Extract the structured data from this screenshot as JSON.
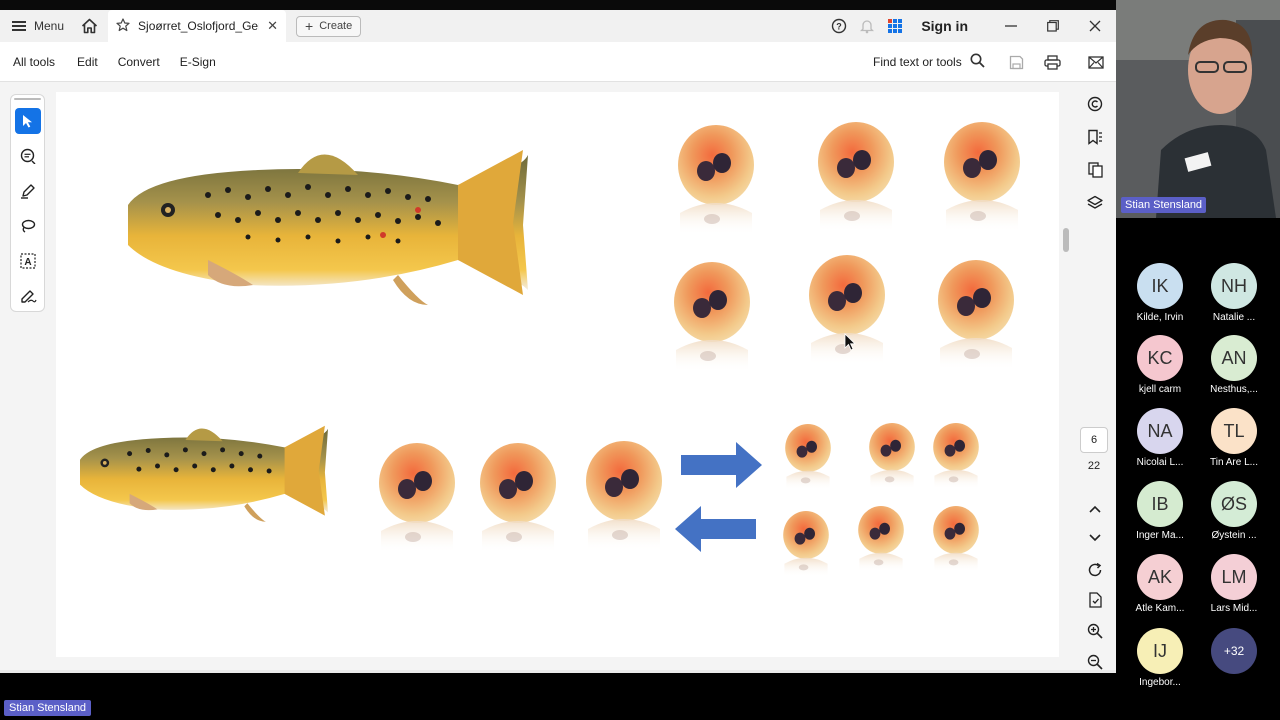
{
  "titlebar": {
    "menu_label": "Menu",
    "tab_title": "Sjoørret_Oslofjord_Gen...",
    "create_label": "Create",
    "sign_in_label": "Sign in"
  },
  "toolbar": {
    "items": [
      "All tools",
      "Edit",
      "Convert",
      "E-Sign"
    ],
    "find_label": "Find text or tools"
  },
  "page_nav": {
    "current_page": "6",
    "total_pages": "22"
  },
  "meeting": {
    "speaker_name": "Stian Stensland",
    "presenter_tag": "Stian Stensland",
    "participants": [
      {
        "initials": "IK",
        "name": "Kilde, Irvin",
        "color": "#c9dff0"
      },
      {
        "initials": "NH",
        "name": "Natalie ...",
        "color": "#cfe7e2"
      },
      {
        "initials": "KC",
        "name": "kjell carm",
        "color": "#f5c7cf"
      },
      {
        "initials": "AN",
        "name": "Nesthus,...",
        "color": "#d9ecd2"
      },
      {
        "initials": "NA",
        "name": "Nicolai L...",
        "color": "#d8d6ee"
      },
      {
        "initials": "TL",
        "name": "Tin Are L...",
        "color": "#fbe2c8"
      },
      {
        "initials": "IB",
        "name": "Inger Ma...",
        "color": "#d5ebd0"
      },
      {
        "initials": "ØS",
        "name": "Øystein ...",
        "color": "#d4ecd6"
      },
      {
        "initials": "AK",
        "name": "Atle Kam...",
        "color": "#f5cfd3"
      },
      {
        "initials": "LM",
        "name": "Lars Mid...",
        "color": "#f4cfd6"
      },
      {
        "initials": "IJ",
        "name": "Ingebor...",
        "color": "#f7efb6"
      }
    ],
    "more_count": "+32"
  },
  "colors": {
    "accent_blue": "#1473e6",
    "arrow_blue": "#4472c4",
    "teams_purple": "#5b5fc7"
  }
}
